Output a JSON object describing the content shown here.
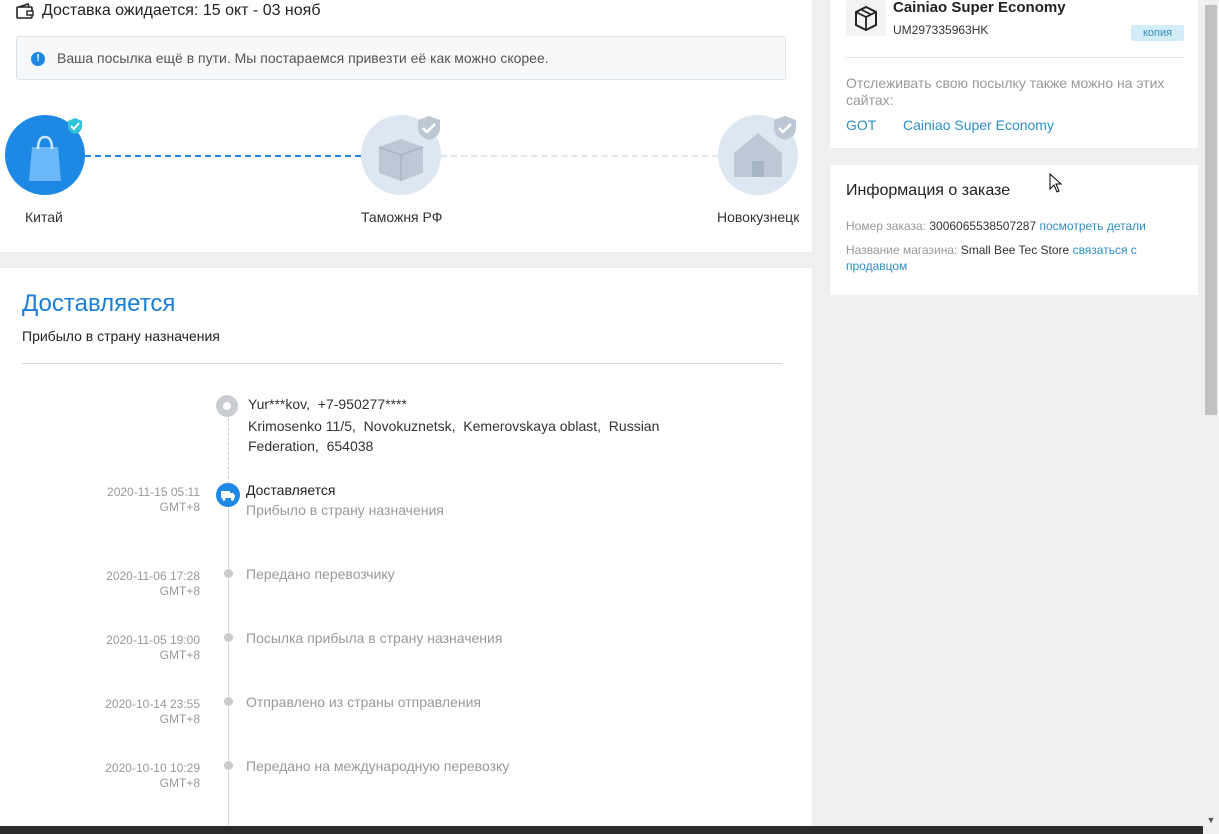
{
  "delivery": {
    "expected_label": "Доставка ожидается: 15 окт - 03 нояб",
    "notice": "Ваша посылка ещё в пути. Мы постараемся привезти её как можно скорее."
  },
  "progress": {
    "nodes": [
      {
        "label": "Китай",
        "icon": "shopping-bag-icon",
        "done": true
      },
      {
        "label": "Таможня РФ",
        "icon": "customs-box-icon",
        "done": false
      },
      {
        "label": "Новокузнецк",
        "icon": "house-icon",
        "done": false
      }
    ]
  },
  "status": {
    "title": "Доставляется",
    "subtitle": "Прибыло в страну назначения"
  },
  "address": {
    "recipient": "Yur***kov,  +7-950277****",
    "line": "Krimosenko 11/5,  Novokuznetsk,  Kemerovskaya oblast,  Russian\nFederation,  654038"
  },
  "events": [
    {
      "date": "2020-11-15 05:11",
      "tz": "GMT+8",
      "title": "Доставляется",
      "subtitle": "Прибыло в страну назначения",
      "active": true
    },
    {
      "date": "2020-11-06 17:28",
      "tz": "GMT+8",
      "title": "Передано перевозчику"
    },
    {
      "date": "2020-11-05 19:00",
      "tz": "GMT+8",
      "title": "Посылка прибыла в страну назначения"
    },
    {
      "date": "2020-10-14 23:55",
      "tz": "GMT+8",
      "title": "Отправлено из страны отправления"
    },
    {
      "date": "2020-10-10 10:29",
      "tz": "GMT+8",
      "title": "Передано на международную перевозку"
    }
  ],
  "carrier": {
    "name": "Cainiao Super Economy",
    "tracking_number": "UM297335963HK",
    "copy_label": "копия",
    "alt_sites_label": "Отслеживать свою посылку также можно на этих сайтах:",
    "links": [
      "GOT",
      "Cainiao Super Economy"
    ]
  },
  "order": {
    "title": "Информация о заказе",
    "number_label": "Номер заказа:",
    "number": "3006065538507287",
    "details_link": "посмотреть детали",
    "store_label": "Название магазина:",
    "store_name": "Small Bee Tec Store",
    "contact_link": "связаться с продавцом"
  },
  "colors": {
    "accent": "#1e88e5",
    "link": "#2a8fc7",
    "background": "#eff0f2"
  }
}
